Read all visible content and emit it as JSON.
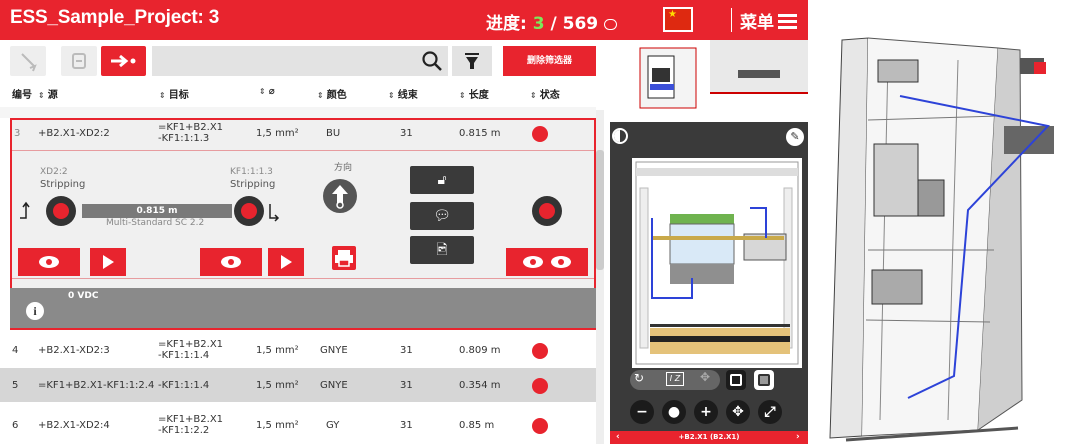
{
  "header": {
    "project": "ESS_Sample_Project: 3",
    "progress_label": "进度:",
    "progress_current": "3",
    "progress_sep": "/",
    "progress_total": "569",
    "flag_glyph": "★",
    "menu_label": "菜单"
  },
  "toolbar": {
    "search_value": "",
    "clear_filter": "删除筛选器"
  },
  "columns": {
    "no": "编号",
    "source": "源",
    "target": "目标",
    "diameter": "⌀",
    "color": "颜色",
    "bundle": "线束",
    "length": "长度",
    "status": "状态"
  },
  "rows": [
    {
      "no": "3",
      "source": "+B2.X1-XD2:2",
      "target1": "=KF1+B2.X1",
      "target2": "-KF1:1:1.3",
      "diameter": "1,5 mm²",
      "color": "BU",
      "bundle": "31",
      "length": "0.815 m"
    },
    {
      "no": "4",
      "source": "+B2.X1-XD2:3",
      "target1": "=KF1+B2.X1",
      "target2": "-KF1:1:1.4",
      "diameter": "1,5 mm²",
      "color": "GNYE",
      "bundle": "31",
      "length": "0.809 m"
    },
    {
      "no": "5",
      "source": "=KF1+B2.X1-KF1:1:2.4",
      "target1": "-KF1:1:1.4",
      "target2": "",
      "diameter": "1,5 mm²",
      "color": "GNYE",
      "bundle": "31",
      "length": "0.354 m"
    },
    {
      "no": "6",
      "source": "+B2.X1-XD2:4",
      "target1": "=KF1+B2.X1",
      "target2": "-KF1:1:2.2",
      "diameter": "1,5 mm²",
      "color": "GY",
      "bundle": "31",
      "length": "0.85 m"
    }
  ],
  "detail": {
    "src_term": "XD2:2",
    "src_proc": "Stripping",
    "tgt_term": "KF1:1:1.3",
    "tgt_proc": "Stripping",
    "wire_len": "0.815 m",
    "wire_type": "Multi-Standard SC 2.2",
    "direction": "方向",
    "voltage": "0 VDC"
  },
  "viewer": {
    "nav_label": "+B2.X1 (B2.X1)"
  },
  "colors": {
    "accent": "#e8242e",
    "progress": "#7ee85b"
  }
}
